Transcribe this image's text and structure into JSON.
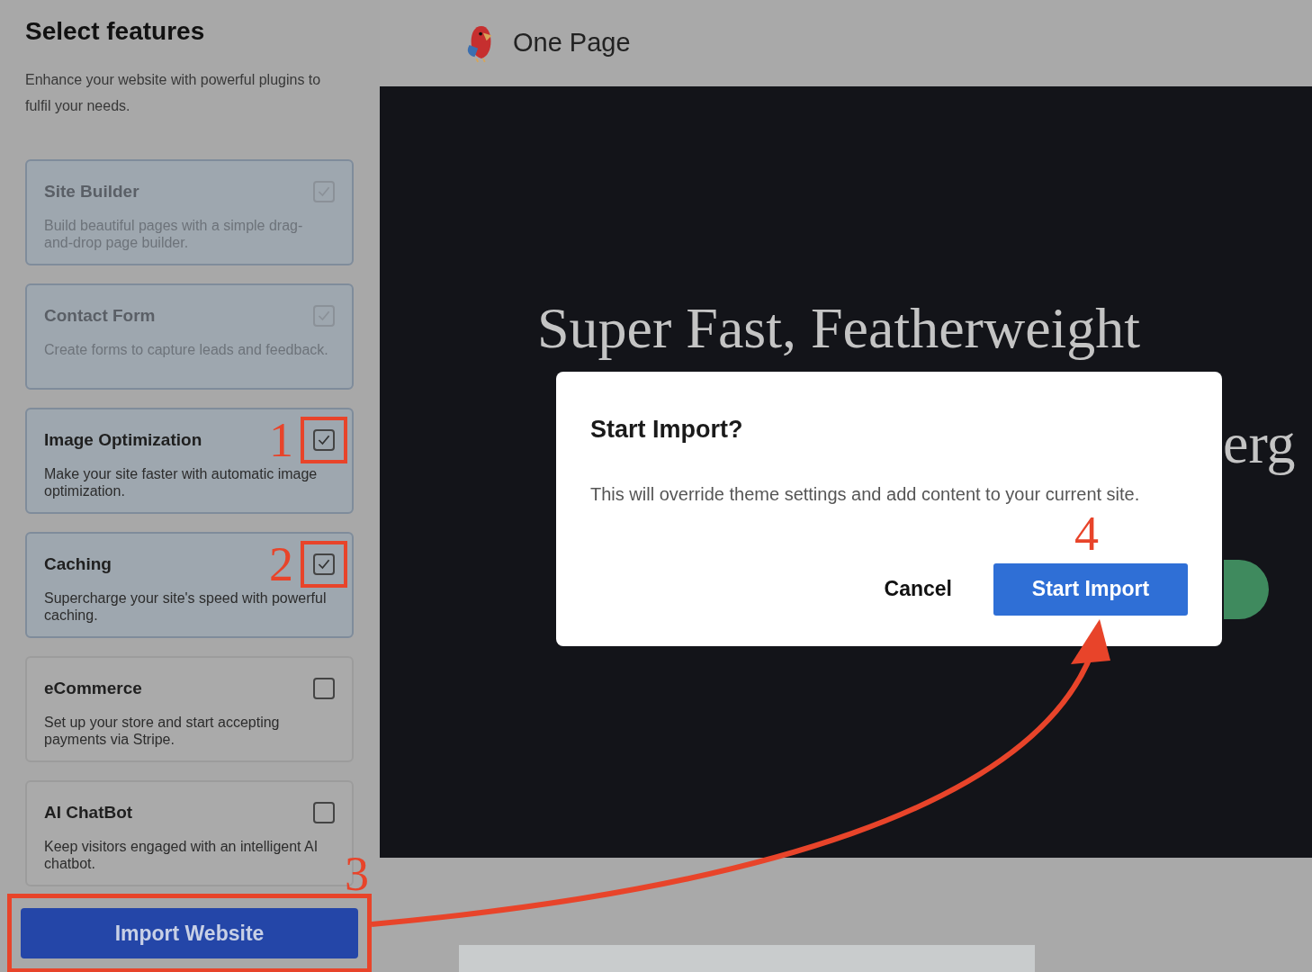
{
  "sidebar": {
    "title": "Select features",
    "description": "Enhance your website with powerful plugins to fulfil your needs.",
    "features": [
      {
        "title": "Site Builder",
        "description": "Build beautiful pages with a simple drag-and-drop page builder.",
        "checked": true,
        "disabled": true,
        "highlighted": false
      },
      {
        "title": "Contact Form",
        "description": "Create forms to capture leads and feedback.",
        "checked": true,
        "disabled": true,
        "highlighted": false
      },
      {
        "title": "Image Optimization",
        "description": "Make your site faster with automatic image optimization.",
        "checked": true,
        "disabled": false,
        "highlighted": true,
        "callout": "1"
      },
      {
        "title": "Caching",
        "description": "Supercharge your site's speed with powerful caching.",
        "checked": true,
        "disabled": false,
        "highlighted": true,
        "callout": "2"
      },
      {
        "title": "eCommerce",
        "description": "Set up your store and start accepting payments via Stripe.",
        "checked": false,
        "disabled": false,
        "highlighted": false
      },
      {
        "title": "AI ChatBot",
        "description": "Keep visitors engaged with an intelligent AI chatbot.",
        "checked": false,
        "disabled": false,
        "highlighted": false
      }
    ],
    "import_button": {
      "label": "Import Website",
      "highlighted": true,
      "callout": "3"
    }
  },
  "preview": {
    "site_name": "One Page",
    "hero_heading": "Super Fast, Featherweight",
    "hero_fragment": "erg"
  },
  "dialog": {
    "title": "Start Import?",
    "message": "This will override theme settings and add content to your current site.",
    "callout": "4",
    "cancel": "Cancel",
    "confirm": "Start Import"
  }
}
